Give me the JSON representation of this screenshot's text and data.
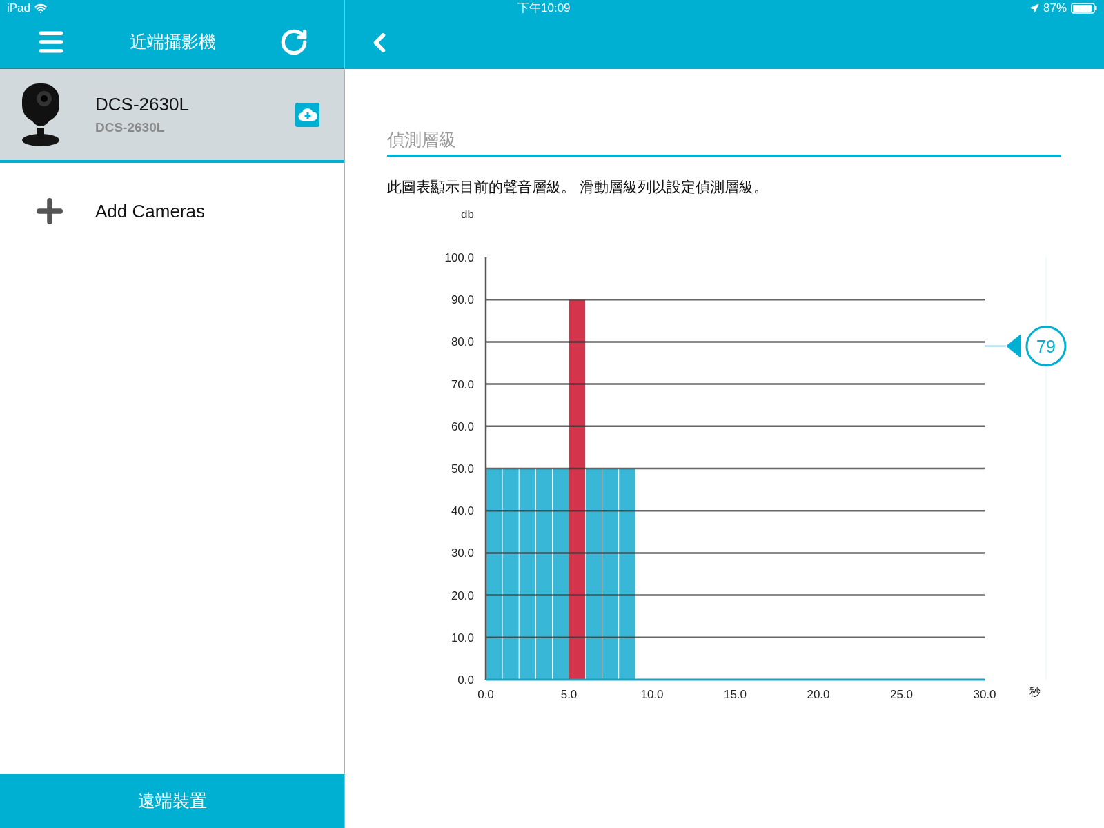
{
  "status_bar": {
    "device": "iPad",
    "time": "下午10:09",
    "battery": "87%"
  },
  "sidebar": {
    "title": "近端攝影機",
    "cameras": [
      {
        "name": "DCS-2630L",
        "model": "DCS-2630L",
        "selected": true
      }
    ],
    "add_label": "Add Cameras",
    "footer_tab": "遠端裝置"
  },
  "detail": {
    "section_title": "偵測層級",
    "description": "此圖表顯示目前的聲音層級。 滑動層級列以設定偵測層級。",
    "slider": {
      "level": 0.79,
      "reading": "79"
    },
    "chart_data": {
      "type": "bar",
      "xlabel": "秒",
      "ylabel": "db",
      "x": [
        0.5,
        1.5,
        2.5,
        3.5,
        4.5,
        5.5,
        6.5,
        7.5,
        8.5
      ],
      "series": [
        {
          "color": "#38b8d6",
          "values": [
            50,
            50,
            50,
            50,
            50,
            null,
            50,
            50,
            50
          ]
        },
        {
          "color": "#d4344c",
          "values": [
            null,
            null,
            null,
            null,
            null,
            90,
            null,
            null,
            null
          ]
        }
      ],
      "grid": true,
      "xlim": [
        0,
        30
      ],
      "ylim": [
        0,
        100
      ],
      "xticks": [
        {
          "value": 0,
          "label": "0.0"
        },
        {
          "value": 5,
          "label": "5.0"
        },
        {
          "value": 10,
          "label": "10.0"
        },
        {
          "value": 15,
          "label": "15.0"
        },
        {
          "value": 20,
          "label": "20.0"
        },
        {
          "value": 25,
          "label": "25.0"
        },
        {
          "value": 30,
          "label": "30.0"
        }
      ],
      "yticks": [
        {
          "value": 0,
          "label": "0.0"
        },
        {
          "value": 10,
          "label": "10.0"
        },
        {
          "value": 20,
          "label": "20.0"
        },
        {
          "value": 30,
          "label": "30.0"
        },
        {
          "value": 40,
          "label": "40.0"
        },
        {
          "value": 50,
          "label": "50.0"
        },
        {
          "value": 60,
          "label": "60.0"
        },
        {
          "value": 70,
          "label": "70.0"
        },
        {
          "value": 80,
          "label": "80.0"
        },
        {
          "value": 90,
          "label": "90.0"
        },
        {
          "value": 100,
          "label": "100.0"
        }
      ]
    }
  }
}
